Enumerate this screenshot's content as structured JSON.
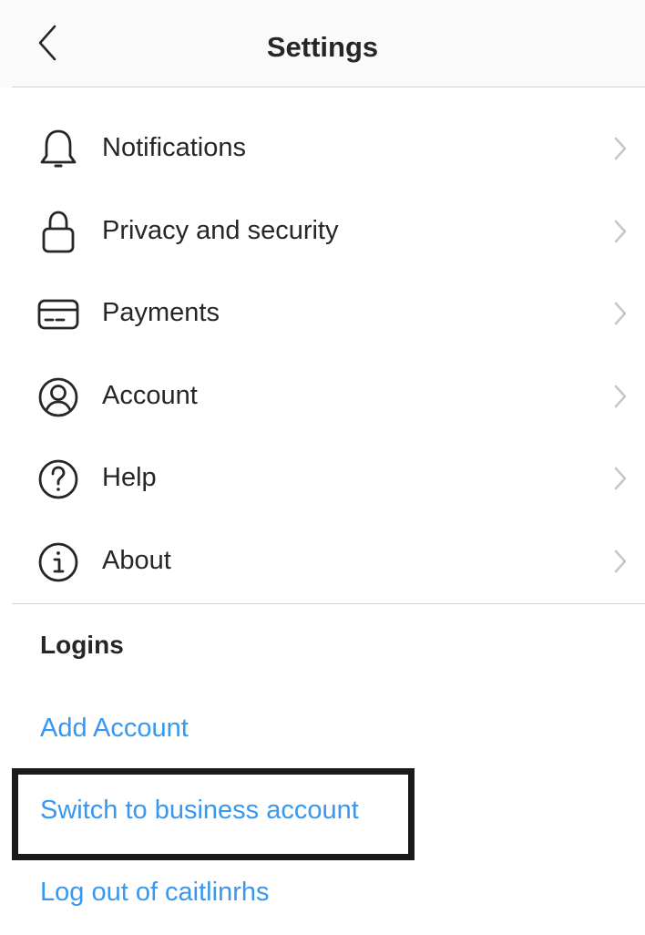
{
  "header": {
    "title": "Settings",
    "back_icon": "chevron-left-icon"
  },
  "menu": {
    "items": [
      {
        "label": "Notifications",
        "icon": "bell-icon"
      },
      {
        "label": "Privacy and security",
        "icon": "lock-icon"
      },
      {
        "label": "Payments",
        "icon": "credit-card-icon"
      },
      {
        "label": "Account",
        "icon": "account-circle-icon"
      },
      {
        "label": "Help",
        "icon": "help-circle-icon"
      },
      {
        "label": "About",
        "icon": "info-circle-icon"
      }
    ],
    "chevron_icon": "chevron-right-icon"
  },
  "logins": {
    "title": "Logins",
    "add_account": "Add Account",
    "switch_business": "Switch to business account",
    "log_out": "Log out of caitlinrhs"
  },
  "colors": {
    "link": "#3897f0",
    "text": "#262626",
    "chevron": "#c7c7c7",
    "divider": "#d4d4d4",
    "highlight_border": "#1a1a1a"
  }
}
